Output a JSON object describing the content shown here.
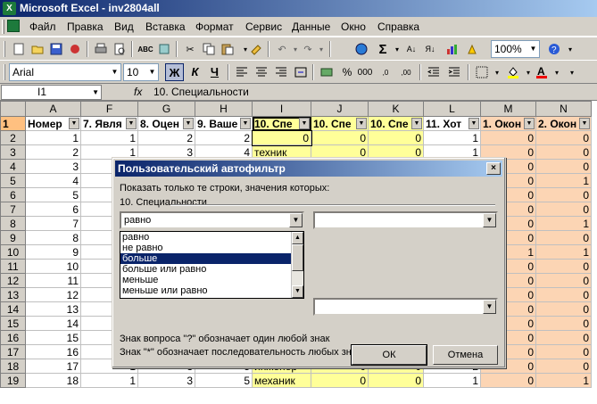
{
  "window": {
    "title": "Microsoft Excel - inv2804all"
  },
  "menu": [
    "Файл",
    "Правка",
    "Вид",
    "Вставка",
    "Формат",
    "Сервис",
    "Данные",
    "Окно",
    "Справка"
  ],
  "toolbar": {
    "zoom": "100%"
  },
  "format_toolbar": {
    "font": "Arial",
    "size": "10",
    "bold": "Ж",
    "italic": "К",
    "underline": "Ч",
    "percent": "%",
    "thousands": "000",
    "dec_inc": ",0",
    "dec_dec": ",00"
  },
  "formula_bar": {
    "cell": "I1",
    "fx": "fx",
    "content": "10. Специальности"
  },
  "sheet": {
    "columns": [
      "A",
      "F",
      "G",
      "H",
      "I",
      "J",
      "K",
      "L",
      "M",
      "N"
    ],
    "headers": [
      "Номер",
      "7. Явля",
      "8. Оцен",
      "9. Ваше",
      "10. Спе",
      "10. Спе",
      "10. Спе",
      "11. Хот",
      "1. Окон",
      "2. Окон"
    ],
    "rows": [
      {
        "n": "2",
        "a": "1",
        "f": "1",
        "g": "2",
        "h": "2",
        "i": "0",
        "j": "0",
        "k": "0",
        "l": "1",
        "m": "0",
        "nn": "0"
      },
      {
        "n": "3",
        "a": "2",
        "f": "1",
        "g": "3",
        "h": "4",
        "i": "техник",
        "j": "0",
        "k": "0",
        "l": "1",
        "m": "0",
        "nn": "0"
      },
      {
        "n": "4",
        "a": "3",
        "f": "",
        "g": "",
        "h": "",
        "i": "",
        "j": "",
        "k": "",
        "l": "",
        "m": "0",
        "nn": "0"
      },
      {
        "n": "5",
        "a": "4",
        "f": "",
        "g": "",
        "h": "",
        "i": "",
        "j": "",
        "k": "",
        "l": "",
        "m": "0",
        "nn": "1"
      },
      {
        "n": "6",
        "a": "5",
        "f": "",
        "g": "",
        "h": "",
        "i": "",
        "j": "",
        "k": "",
        "l": "",
        "m": "0",
        "nn": "0"
      },
      {
        "n": "7",
        "a": "6",
        "f": "",
        "g": "",
        "h": "",
        "i": "",
        "j": "",
        "k": "",
        "l": "",
        "m": "0",
        "nn": "0"
      },
      {
        "n": "8",
        "a": "7",
        "f": "",
        "g": "",
        "h": "",
        "i": "",
        "j": "",
        "k": "",
        "l": "",
        "m": "0",
        "nn": "1"
      },
      {
        "n": "9",
        "a": "8",
        "f": "",
        "g": "",
        "h": "",
        "i": "",
        "j": "",
        "k": "",
        "l": "",
        "m": "0",
        "nn": "0"
      },
      {
        "n": "10",
        "a": "9",
        "f": "",
        "g": "",
        "h": "",
        "i": "",
        "j": "",
        "k": "",
        "l": "",
        "m": "1",
        "nn": "1"
      },
      {
        "n": "11",
        "a": "10",
        "f": "",
        "g": "",
        "h": "",
        "i": "",
        "j": "",
        "k": "",
        "l": "",
        "m": "0",
        "nn": "0"
      },
      {
        "n": "12",
        "a": "11",
        "f": "",
        "g": "",
        "h": "",
        "i": "",
        "j": "",
        "k": "",
        "l": "",
        "m": "0",
        "nn": "0"
      },
      {
        "n": "13",
        "a": "12",
        "f": "",
        "g": "",
        "h": "",
        "i": "",
        "j": "",
        "k": "",
        "l": "",
        "m": "0",
        "nn": "0"
      },
      {
        "n": "14",
        "a": "13",
        "f": "",
        "g": "",
        "h": "",
        "i": "",
        "j": "",
        "k": "",
        "l": "",
        "m": "0",
        "nn": "0"
      },
      {
        "n": "15",
        "a": "14",
        "f": "",
        "g": "",
        "h": "",
        "i": "",
        "j": "",
        "k": "",
        "l": "",
        "m": "0",
        "nn": "0"
      },
      {
        "n": "16",
        "a": "15",
        "f": "",
        "g": "",
        "h": "",
        "i": "",
        "j": "",
        "k": "",
        "l": "",
        "m": "0",
        "nn": "0"
      },
      {
        "n": "17",
        "a": "16",
        "f": "",
        "g": "",
        "h": "",
        "i": "",
        "j": "",
        "k": "",
        "l": "",
        "m": "0",
        "nn": "0"
      },
      {
        "n": "18",
        "a": "17",
        "f": "1",
        "g": "3",
        "h": "5",
        "i": "инженер",
        "j": "0",
        "k": "0",
        "l": "2",
        "m": "0",
        "nn": "0"
      },
      {
        "n": "19",
        "a": "18",
        "f": "1",
        "g": "3",
        "h": "5",
        "i": "механик",
        "j": "0",
        "k": "0",
        "l": "1",
        "m": "0",
        "nn": "1"
      }
    ]
  },
  "dialog": {
    "title": "Пользовательский автофильтр",
    "prompt": "Показать только те строки, значения которых:",
    "field": "10. Специальности",
    "cond1": "равно",
    "options": [
      "равно",
      "не равно",
      "больше",
      "больше или равно",
      "меньше",
      "меньше или равно"
    ],
    "hint1": "Знак вопроса \"?\" обозначает один любой знак",
    "hint2": "Знак \"*\" обозначает последовательность любых знаков",
    "ok": "ОК",
    "cancel": "Отмена",
    "close": "×"
  }
}
